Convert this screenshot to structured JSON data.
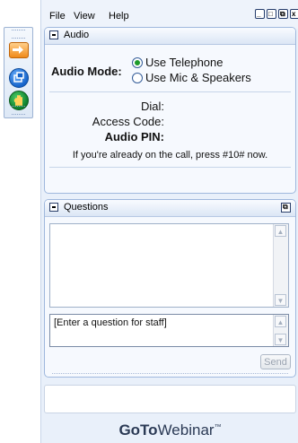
{
  "menu": {
    "file": "File",
    "view": "View",
    "help": "Help"
  },
  "window_controls": {
    "minimize": "_",
    "maximize": "□",
    "restore": "⧉",
    "close": "x"
  },
  "audio": {
    "title": "Audio",
    "mode_label": "Audio Mode:",
    "options": [
      "Use Telephone",
      "Use Mic & Speakers"
    ],
    "selected": "Use Telephone",
    "dial_label": "Dial:",
    "access_code_label": "Access Code:",
    "audio_pin_label": "Audio PIN:",
    "note": "If you're already on the call, press #10# now."
  },
  "questions": {
    "title": "Questions",
    "input_placeholder": "[Enter a question for staff]",
    "send_label": "Send"
  },
  "logo": {
    "goto": "GoTo",
    "webinar": "Webinar",
    "tm": "™"
  },
  "icons": [
    "exit-arrow-icon",
    "window-switch-icon",
    "raise-hand-icon"
  ]
}
